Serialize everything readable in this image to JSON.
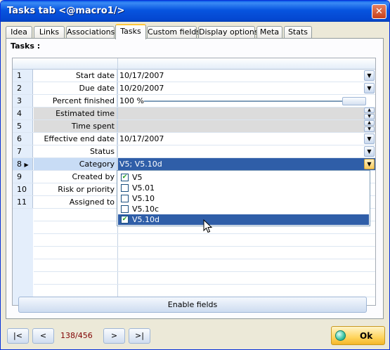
{
  "window": {
    "title": "Tasks tab <@macro1/>",
    "close_glyph": "✕"
  },
  "tabs": [
    "Idea",
    "Links",
    "Associations",
    "Tasks",
    "Custom fields",
    "Display options",
    "Meta",
    "Stats"
  ],
  "active_tab": "Tasks",
  "section_label": "Tasks :",
  "rows": [
    {
      "num": "1",
      "label": "Start date",
      "value": "10/17/2007"
    },
    {
      "num": "2",
      "label": "Due date",
      "value": "10/20/2007"
    },
    {
      "num": "3",
      "label": "Percent finished",
      "value": "100 %"
    },
    {
      "num": "4",
      "label": "Estimated time",
      "value": ""
    },
    {
      "num": "5",
      "label": "Time spent",
      "value": ""
    },
    {
      "num": "6",
      "label": "Effective end date",
      "value": "10/17/2007"
    },
    {
      "num": "7",
      "label": "Status",
      "value": ""
    },
    {
      "num": "8",
      "label": "Category",
      "value": "V5; V5.10d"
    },
    {
      "num": "9",
      "label": "Created by",
      "value": ""
    },
    {
      "num": "10",
      "label": "Risk or priority",
      "value": ""
    },
    {
      "num": "11",
      "label": "Assigned to",
      "value": ""
    }
  ],
  "percent_finished_value": 1.0,
  "category_dropdown": [
    {
      "label": "V5",
      "checked": true
    },
    {
      "label": "V5.01",
      "checked": false
    },
    {
      "label": "V5.10",
      "checked": false
    },
    {
      "label": "V5.10c",
      "checked": false
    },
    {
      "label": "V5.10d",
      "checked": true
    }
  ],
  "enable_button": "Enable fields",
  "nav": {
    "first": "|<",
    "prev": "<",
    "counter": "138/456",
    "next": ">",
    "last": ">|"
  },
  "ok_button": "Ok",
  "colors": {
    "title_bar": "#0754df",
    "selection": "#2f5ea8",
    "counter_text": "#800000",
    "ok_accent": "#ffd55e"
  }
}
